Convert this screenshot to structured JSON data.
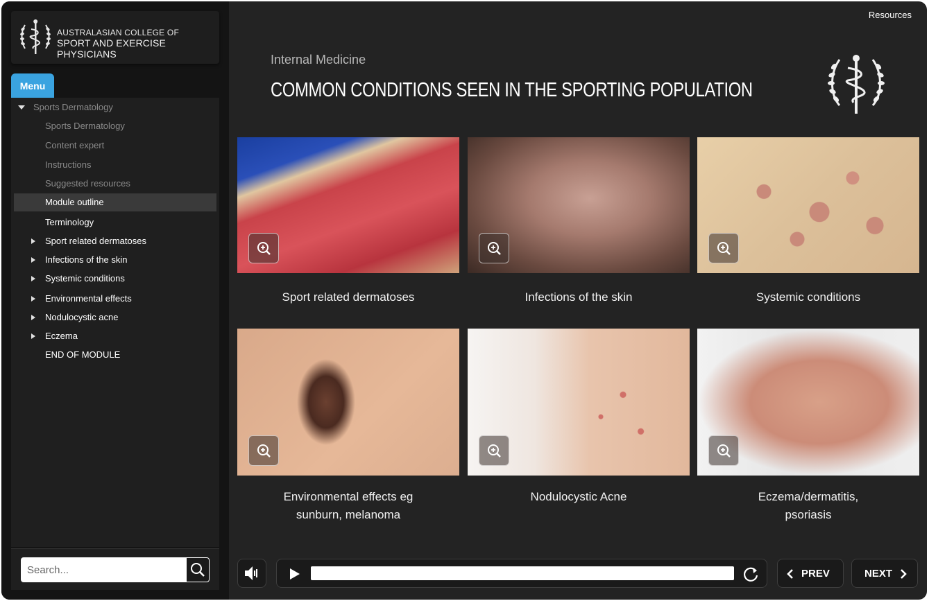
{
  "header": {
    "org_line1": "AUSTRALASIAN COLLEGE OF",
    "org_line2": "SPORT AND EXERCISE PHYSICIANS",
    "resources_label": "Resources"
  },
  "sidebar": {
    "menu_tab": "Menu",
    "items": [
      {
        "label": "Sports Dermatology"
      },
      {
        "label": "Sports Dermatology"
      },
      {
        "label": "Content expert"
      },
      {
        "label": "Instructions"
      },
      {
        "label": "Suggested resources"
      },
      {
        "label": "Module outline"
      },
      {
        "label": "Terminology"
      },
      {
        "label": "Sport related dermatoses"
      },
      {
        "label": "Infections of the skin"
      },
      {
        "label": "Systemic conditions"
      },
      {
        "label": "Environmental effects"
      },
      {
        "label": "Nodulocystic acne"
      },
      {
        "label": "Eczema"
      },
      {
        "label": "END OF MODULE"
      }
    ],
    "search_placeholder": "Search..."
  },
  "main": {
    "subtitle": "Internal Medicine",
    "title": "COMMON CONDITIONS SEEN IN THE SPORTING POPULATION",
    "cards": [
      {
        "caption": "Sport related dermatoses"
      },
      {
        "caption": "Infections of the skin"
      },
      {
        "caption": "Systemic conditions"
      },
      {
        "caption_line1": "Environmental effects eg",
        "caption_line2": "sunburn, melanoma"
      },
      {
        "caption": "Nodulocystic Acne"
      },
      {
        "caption_line1": "Eczema/dermatitis,",
        "caption_line2": "psoriasis"
      }
    ]
  },
  "player": {
    "prev_label": "PREV",
    "next_label": "NEXT",
    "progress": 0
  },
  "colors": {
    "accent": "#3aa3e0",
    "background": "#232323",
    "sidebar": "#141414"
  }
}
